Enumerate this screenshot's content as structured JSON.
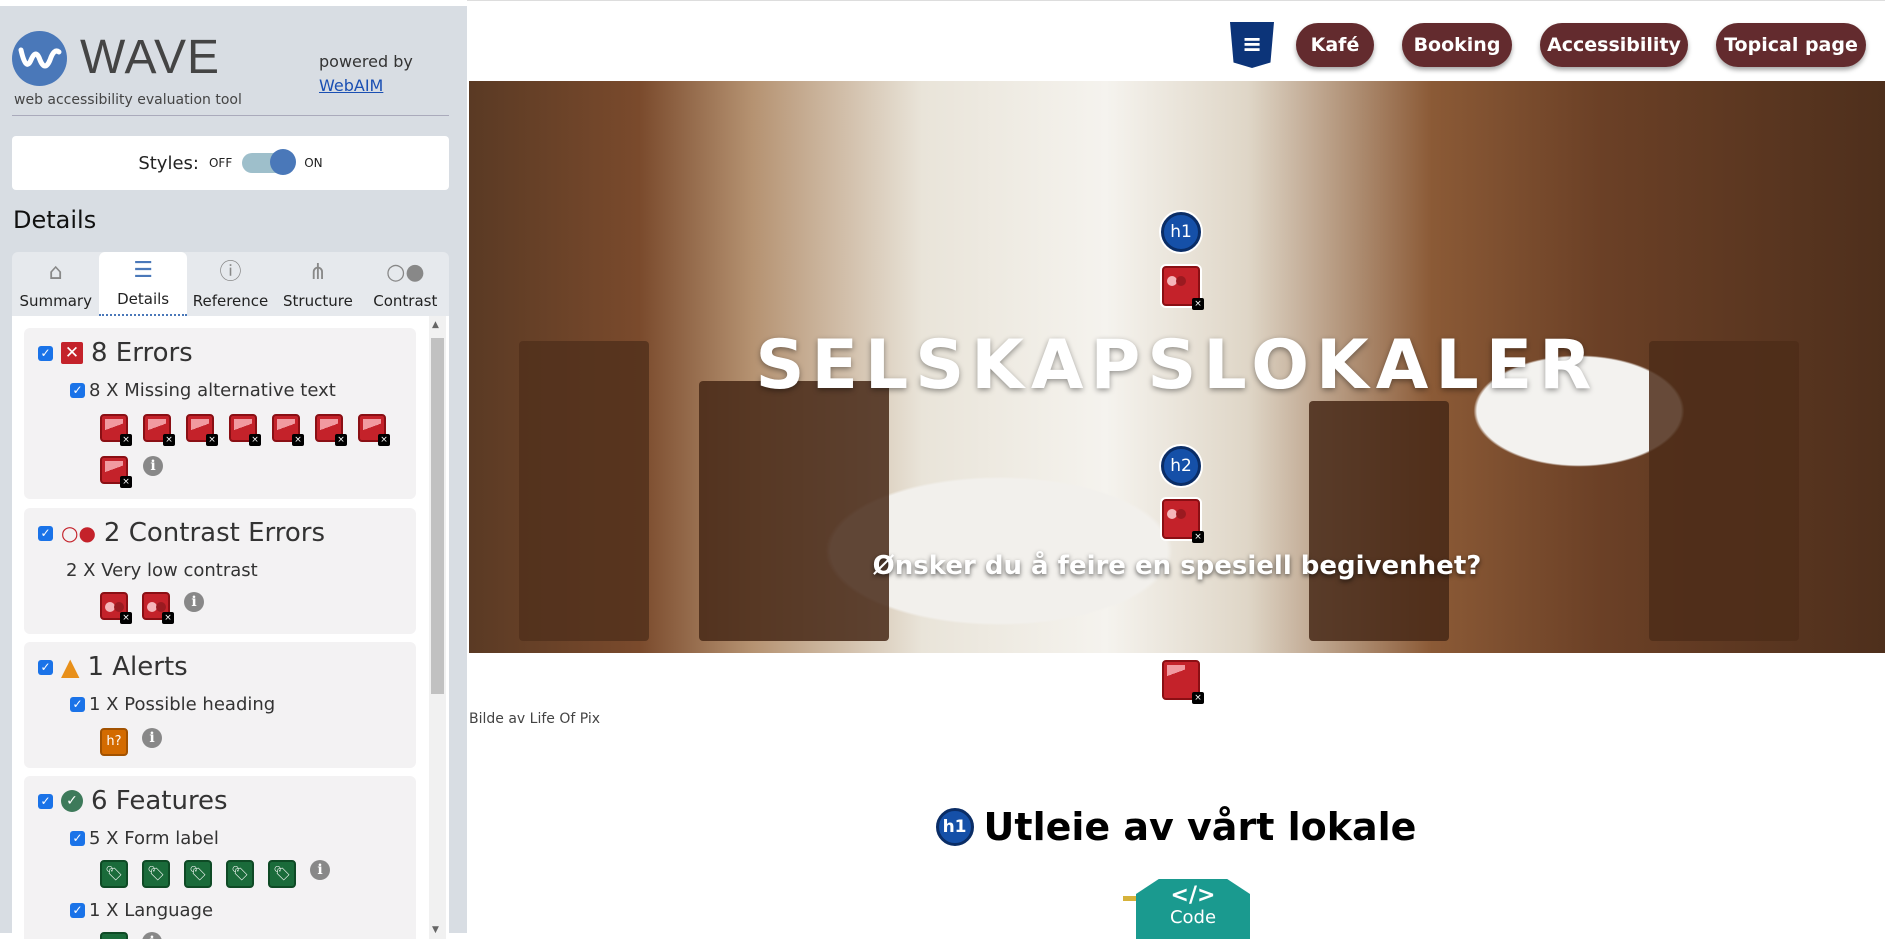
{
  "wave": {
    "title": "WAVE",
    "tagline": "web accessibility evaluation tool",
    "powered_by": "powered by",
    "webaim": "WebAIM",
    "styles_label": "Styles:",
    "off": "OFF",
    "on": "ON",
    "styles_on": true,
    "details_heading": "Details",
    "tabs": [
      {
        "label": "Summary",
        "icon": "home-icon"
      },
      {
        "label": "Details",
        "icon": "list-icon",
        "active": true
      },
      {
        "label": "Reference",
        "icon": "info-icon"
      },
      {
        "label": "Structure",
        "icon": "hierarchy-icon"
      },
      {
        "label": "Contrast",
        "icon": "contrast-icon"
      }
    ],
    "errors": {
      "title": "8 Errors",
      "items": [
        {
          "label": "8 X Missing alternative text",
          "count": 8
        }
      ]
    },
    "contrast": {
      "title": "2 Contrast Errors",
      "items": [
        {
          "label": "2 X Very low contrast",
          "count": 2
        }
      ]
    },
    "alerts": {
      "title": "1 Alerts",
      "items": [
        {
          "label": "1 X Possible heading",
          "count": 1,
          "icon_text": "h?"
        }
      ]
    },
    "features": {
      "title": "6 Features",
      "items": [
        {
          "label": "5 X Form label",
          "count": 5
        },
        {
          "label": "1 X Language",
          "count": 1
        }
      ]
    }
  },
  "site": {
    "nav": [
      "Kafé",
      "Booking",
      "Accessibility",
      "Topical page"
    ],
    "hero_title": "SELSKAPSLOKALER",
    "hero_subtitle": "Ønsker du å feire en spesiell begivenhet?",
    "caption": "Bilde av Life Of Pix",
    "section_heading": "Utleie av vårt lokale",
    "h1": "h1",
    "h2": "h2",
    "code_label": "Code",
    "code_icon": "</>"
  },
  "colors": {
    "wave_blue": "#4a78b9",
    "nav_button": "#632b2e",
    "error": "#c4222a",
    "alert": "#d36b00",
    "feature": "#1a6b3a",
    "code": "#1a9a8f"
  }
}
